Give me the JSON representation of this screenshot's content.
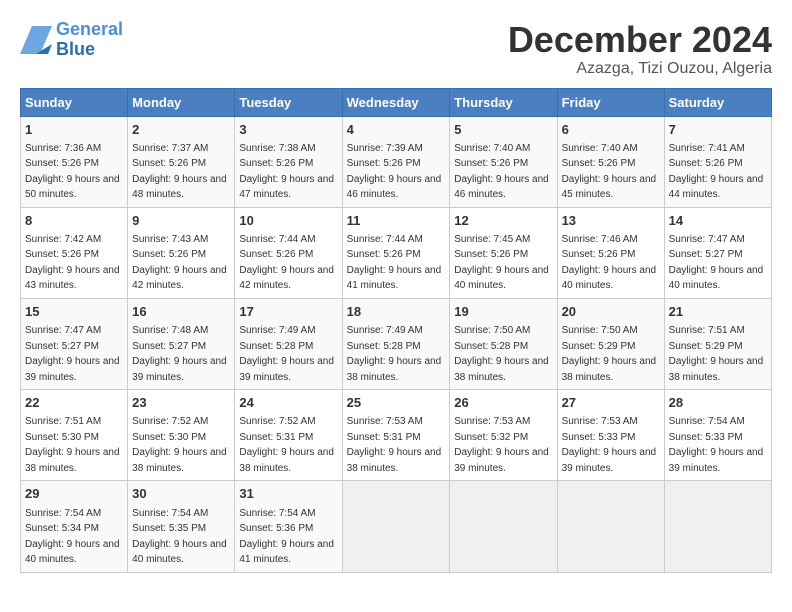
{
  "header": {
    "logo_line1": "General",
    "logo_line2": "Blue",
    "month": "December 2024",
    "location": "Azazga, Tizi Ouzou, Algeria"
  },
  "days_of_week": [
    "Sunday",
    "Monday",
    "Tuesday",
    "Wednesday",
    "Thursday",
    "Friday",
    "Saturday"
  ],
  "weeks": [
    [
      {
        "num": "1",
        "sunrise": "Sunrise: 7:36 AM",
        "sunset": "Sunset: 5:26 PM",
        "daylight": "Daylight: 9 hours and 50 minutes."
      },
      {
        "num": "2",
        "sunrise": "Sunrise: 7:37 AM",
        "sunset": "Sunset: 5:26 PM",
        "daylight": "Daylight: 9 hours and 48 minutes."
      },
      {
        "num": "3",
        "sunrise": "Sunrise: 7:38 AM",
        "sunset": "Sunset: 5:26 PM",
        "daylight": "Daylight: 9 hours and 47 minutes."
      },
      {
        "num": "4",
        "sunrise": "Sunrise: 7:39 AM",
        "sunset": "Sunset: 5:26 PM",
        "daylight": "Daylight: 9 hours and 46 minutes."
      },
      {
        "num": "5",
        "sunrise": "Sunrise: 7:40 AM",
        "sunset": "Sunset: 5:26 PM",
        "daylight": "Daylight: 9 hours and 46 minutes."
      },
      {
        "num": "6",
        "sunrise": "Sunrise: 7:40 AM",
        "sunset": "Sunset: 5:26 PM",
        "daylight": "Daylight: 9 hours and 45 minutes."
      },
      {
        "num": "7",
        "sunrise": "Sunrise: 7:41 AM",
        "sunset": "Sunset: 5:26 PM",
        "daylight": "Daylight: 9 hours and 44 minutes."
      }
    ],
    [
      {
        "num": "8",
        "sunrise": "Sunrise: 7:42 AM",
        "sunset": "Sunset: 5:26 PM",
        "daylight": "Daylight: 9 hours and 43 minutes."
      },
      {
        "num": "9",
        "sunrise": "Sunrise: 7:43 AM",
        "sunset": "Sunset: 5:26 PM",
        "daylight": "Daylight: 9 hours and 42 minutes."
      },
      {
        "num": "10",
        "sunrise": "Sunrise: 7:44 AM",
        "sunset": "Sunset: 5:26 PM",
        "daylight": "Daylight: 9 hours and 42 minutes."
      },
      {
        "num": "11",
        "sunrise": "Sunrise: 7:44 AM",
        "sunset": "Sunset: 5:26 PM",
        "daylight": "Daylight: 9 hours and 41 minutes."
      },
      {
        "num": "12",
        "sunrise": "Sunrise: 7:45 AM",
        "sunset": "Sunset: 5:26 PM",
        "daylight": "Daylight: 9 hours and 40 minutes."
      },
      {
        "num": "13",
        "sunrise": "Sunrise: 7:46 AM",
        "sunset": "Sunset: 5:26 PM",
        "daylight": "Daylight: 9 hours and 40 minutes."
      },
      {
        "num": "14",
        "sunrise": "Sunrise: 7:47 AM",
        "sunset": "Sunset: 5:27 PM",
        "daylight": "Daylight: 9 hours and 40 minutes."
      }
    ],
    [
      {
        "num": "15",
        "sunrise": "Sunrise: 7:47 AM",
        "sunset": "Sunset: 5:27 PM",
        "daylight": "Daylight: 9 hours and 39 minutes."
      },
      {
        "num": "16",
        "sunrise": "Sunrise: 7:48 AM",
        "sunset": "Sunset: 5:27 PM",
        "daylight": "Daylight: 9 hours and 39 minutes."
      },
      {
        "num": "17",
        "sunrise": "Sunrise: 7:49 AM",
        "sunset": "Sunset: 5:28 PM",
        "daylight": "Daylight: 9 hours and 39 minutes."
      },
      {
        "num": "18",
        "sunrise": "Sunrise: 7:49 AM",
        "sunset": "Sunset: 5:28 PM",
        "daylight": "Daylight: 9 hours and 38 minutes."
      },
      {
        "num": "19",
        "sunrise": "Sunrise: 7:50 AM",
        "sunset": "Sunset: 5:28 PM",
        "daylight": "Daylight: 9 hours and 38 minutes."
      },
      {
        "num": "20",
        "sunrise": "Sunrise: 7:50 AM",
        "sunset": "Sunset: 5:29 PM",
        "daylight": "Daylight: 9 hours and 38 minutes."
      },
      {
        "num": "21",
        "sunrise": "Sunrise: 7:51 AM",
        "sunset": "Sunset: 5:29 PM",
        "daylight": "Daylight: 9 hours and 38 minutes."
      }
    ],
    [
      {
        "num": "22",
        "sunrise": "Sunrise: 7:51 AM",
        "sunset": "Sunset: 5:30 PM",
        "daylight": "Daylight: 9 hours and 38 minutes."
      },
      {
        "num": "23",
        "sunrise": "Sunrise: 7:52 AM",
        "sunset": "Sunset: 5:30 PM",
        "daylight": "Daylight: 9 hours and 38 minutes."
      },
      {
        "num": "24",
        "sunrise": "Sunrise: 7:52 AM",
        "sunset": "Sunset: 5:31 PM",
        "daylight": "Daylight: 9 hours and 38 minutes."
      },
      {
        "num": "25",
        "sunrise": "Sunrise: 7:53 AM",
        "sunset": "Sunset: 5:31 PM",
        "daylight": "Daylight: 9 hours and 38 minutes."
      },
      {
        "num": "26",
        "sunrise": "Sunrise: 7:53 AM",
        "sunset": "Sunset: 5:32 PM",
        "daylight": "Daylight: 9 hours and 39 minutes."
      },
      {
        "num": "27",
        "sunrise": "Sunrise: 7:53 AM",
        "sunset": "Sunset: 5:33 PM",
        "daylight": "Daylight: 9 hours and 39 minutes."
      },
      {
        "num": "28",
        "sunrise": "Sunrise: 7:54 AM",
        "sunset": "Sunset: 5:33 PM",
        "daylight": "Daylight: 9 hours and 39 minutes."
      }
    ],
    [
      {
        "num": "29",
        "sunrise": "Sunrise: 7:54 AM",
        "sunset": "Sunset: 5:34 PM",
        "daylight": "Daylight: 9 hours and 40 minutes."
      },
      {
        "num": "30",
        "sunrise": "Sunrise: 7:54 AM",
        "sunset": "Sunset: 5:35 PM",
        "daylight": "Daylight: 9 hours and 40 minutes."
      },
      {
        "num": "31",
        "sunrise": "Sunrise: 7:54 AM",
        "sunset": "Sunset: 5:36 PM",
        "daylight": "Daylight: 9 hours and 41 minutes."
      },
      null,
      null,
      null,
      null
    ]
  ]
}
